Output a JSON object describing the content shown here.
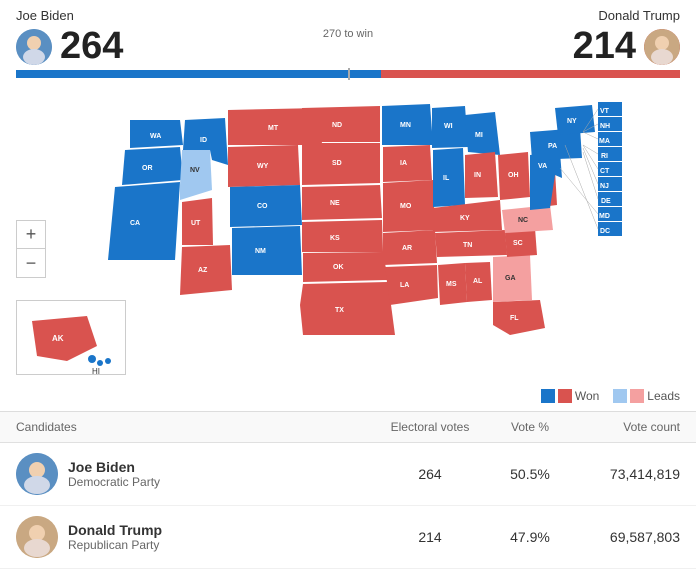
{
  "header": {
    "biden_name": "Joe Biden",
    "biden_electoral": "264",
    "trump_name": "Donald Trump",
    "trump_electoral": "214",
    "to_win_label": "270 to win"
  },
  "progress": {
    "biden_pct": 55,
    "trump_pct": 45
  },
  "legend": {
    "won_label": "Won",
    "leads_label": "Leads"
  },
  "table": {
    "col_candidates": "Candidates",
    "col_electoral": "Electoral votes",
    "col_vote_pct": "Vote %",
    "col_vote_count": "Vote count",
    "rows": [
      {
        "name": "Joe Biden",
        "party": "Democratic Party",
        "electoral": "264",
        "vote_pct": "50.5%",
        "vote_count": "73,414,819"
      },
      {
        "name": "Donald Trump",
        "party": "Republican Party",
        "electoral": "214",
        "vote_pct": "47.9%",
        "vote_count": "69,587,803"
      }
    ]
  },
  "zoom": {
    "plus": "+",
    "minus": "−"
  }
}
